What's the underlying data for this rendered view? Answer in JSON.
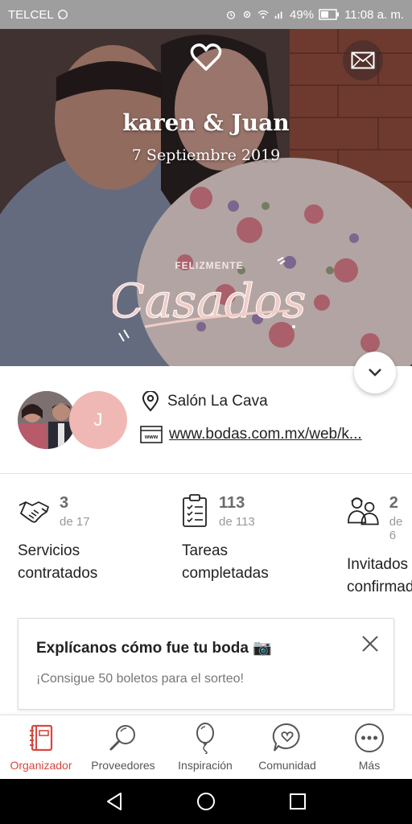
{
  "status_bar": {
    "carrier": "TELCEL",
    "battery": "49%",
    "time": "11:08 a. m."
  },
  "hero": {
    "couple_name": "karen & Juan",
    "date": "7 Septiembre 2019",
    "stamp_small": "FELIZMENTE",
    "stamp_big": "Casados"
  },
  "info": {
    "avatar_initial": "J",
    "venue": "Salón La Cava",
    "website": "www.bodas.com.mx/web/k..."
  },
  "stats": [
    {
      "value": "3",
      "of": "de 17",
      "label_line1": "Servicios",
      "label_line2": "contratados",
      "icon": "handshake-icon"
    },
    {
      "value": "113",
      "of": "de 113",
      "label_line1": "Tareas",
      "label_line2": "completadas",
      "icon": "clipboard-checklist-icon"
    },
    {
      "value": "2",
      "of": "de 6",
      "label_line1": "Invitados",
      "label_line2": "confirmados",
      "icon": "guests-icon"
    }
  ],
  "card": {
    "title": "Explícanos cómo fue tu boda 📷",
    "subtitle": "¡Consigue 50 boletos para el sorteo!"
  },
  "bottom_nav": [
    {
      "label": "Organizador",
      "icon": "planner-book-icon",
      "active": true
    },
    {
      "label": "Proveedores",
      "icon": "magnifier-icon",
      "active": false
    },
    {
      "label": "Inspiración",
      "icon": "balloon-icon",
      "active": false
    },
    {
      "label": "Comunidad",
      "icon": "chat-heart-icon",
      "active": false
    },
    {
      "label": "Más",
      "icon": "more-dots-icon",
      "active": false
    }
  ],
  "colors": {
    "accent": "#d9463f",
    "avatar_bg": "#f0b8b4",
    "status_bar": "#9e9e9e"
  }
}
